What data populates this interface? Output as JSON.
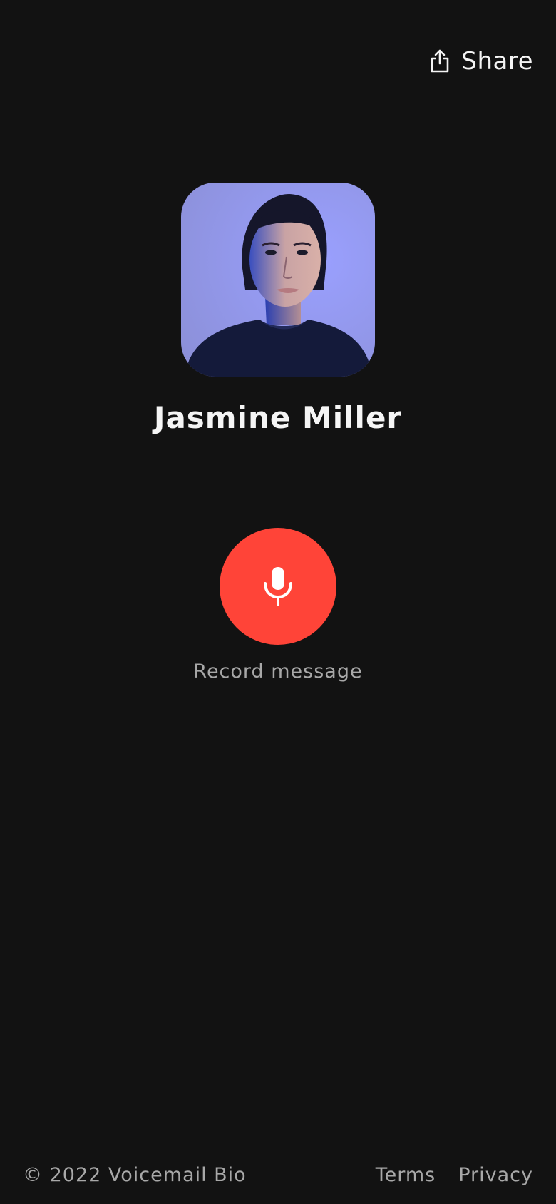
{
  "header": {
    "share_label": "Share",
    "share_icon": "share-icon"
  },
  "profile": {
    "name": "Jasmine Miller",
    "avatar_icon": "avatar-photo"
  },
  "record": {
    "label": "Record message",
    "icon": "microphone-icon",
    "button_color": "#ff4438"
  },
  "footer": {
    "copyright": "© 2022 Voicemail Bio",
    "links": [
      {
        "label": "Terms"
      },
      {
        "label": "Privacy"
      }
    ]
  },
  "colors": {
    "background": "#121212",
    "accent": "#ff4438",
    "muted_text": "#a8a8a8"
  }
}
